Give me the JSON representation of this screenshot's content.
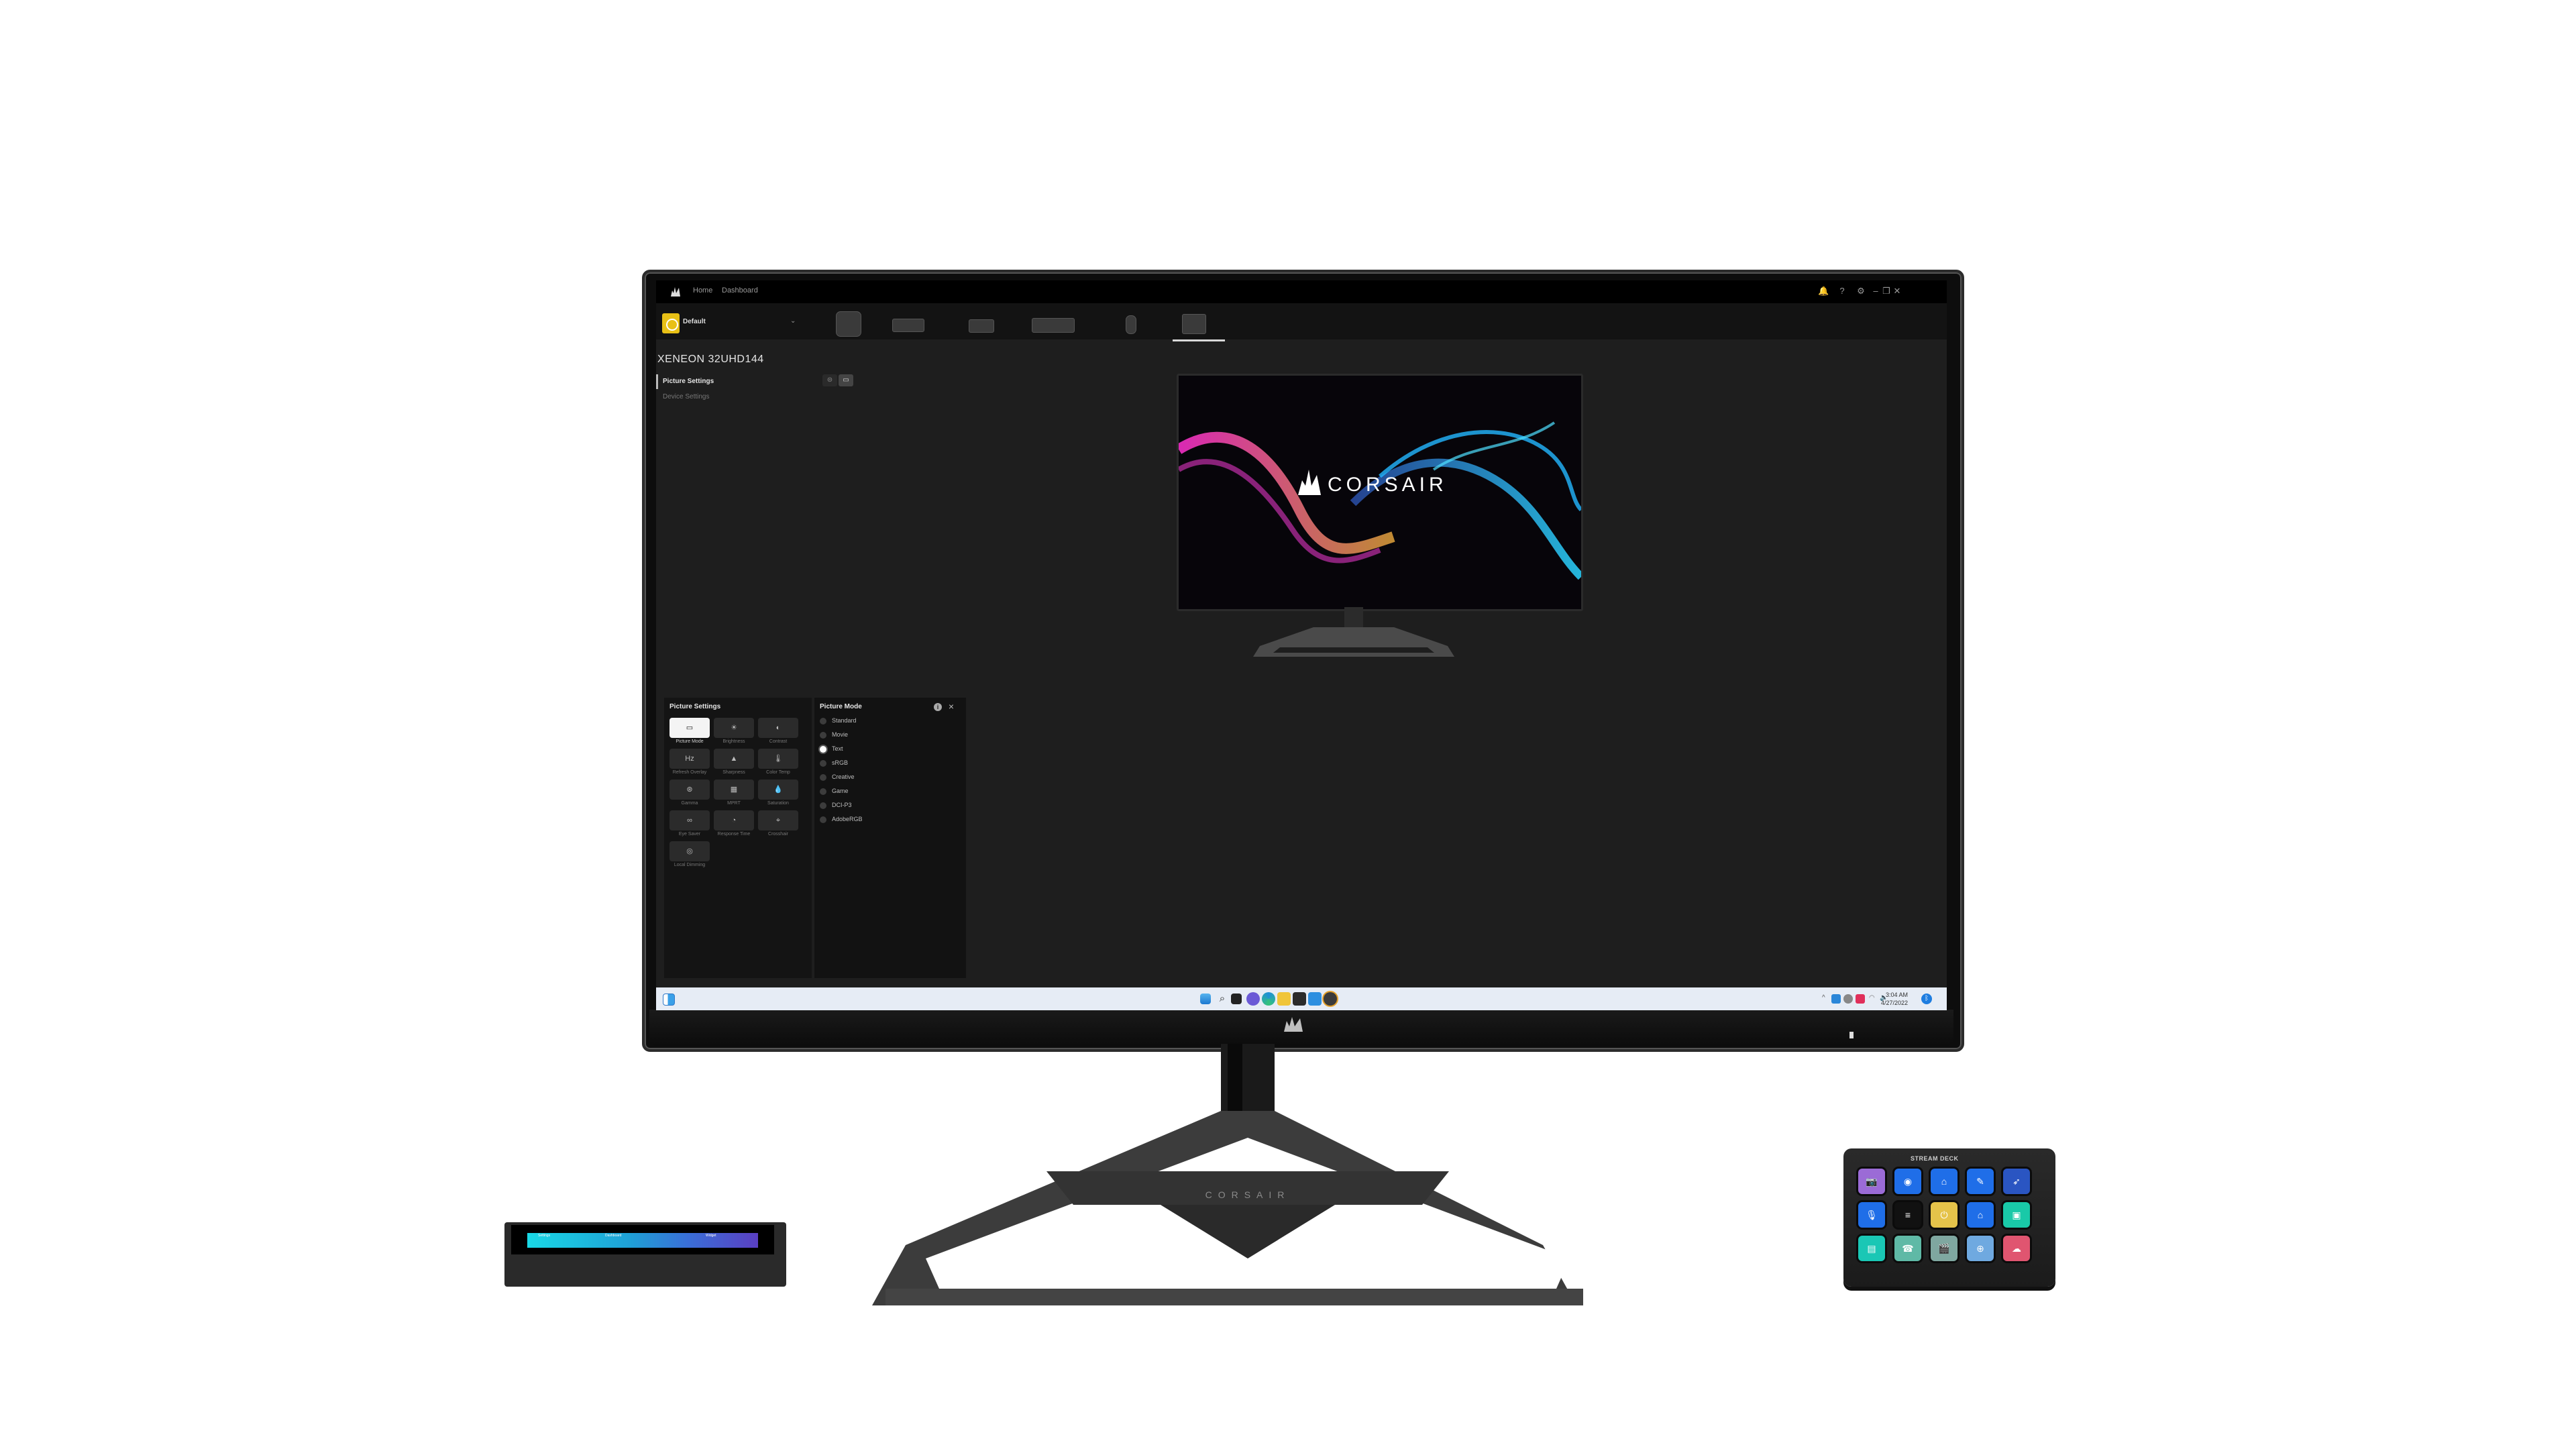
{
  "app": {
    "nav_links": [
      "Home",
      "Dashboard"
    ],
    "window_icons": [
      "bell-icon",
      "help-icon",
      "gear-icon",
      "minimize-icon",
      "restore-icon",
      "close-icon"
    ],
    "profile": {
      "name": "Default",
      "color": "#e8c016"
    },
    "devices": [
      "cooler",
      "memory",
      "mousepad",
      "keyboard",
      "mouse",
      "monitor"
    ],
    "active_device_index": 5,
    "device_title": "XENEON 32UHD144",
    "nav": [
      {
        "label": "Picture Settings",
        "active": true
      },
      {
        "label": "Device Settings",
        "active": false
      }
    ],
    "preview_brand": "CORSAIR",
    "picture_settings": {
      "title": "Picture Settings",
      "tiles": [
        {
          "label": "Picture Mode",
          "icon": "▭",
          "selected": true
        },
        {
          "label": "Brightness",
          "icon": "☀"
        },
        {
          "label": "Contrast",
          "icon": "◐"
        },
        {
          "label": "Refresh Overlay",
          "icon": "Hz"
        },
        {
          "label": "Sharpness",
          "icon": "▲"
        },
        {
          "label": "Color Temp",
          "icon": "🌡"
        },
        {
          "label": "Gamma",
          "icon": "⊛"
        },
        {
          "label": "MPRT",
          "icon": "▦"
        },
        {
          "label": "Saturation",
          "icon": "💧"
        },
        {
          "label": "Eye Saver",
          "icon": "∞"
        },
        {
          "label": "Response Time",
          "icon": "◔"
        },
        {
          "label": "Crosshair",
          "icon": "⌖"
        },
        {
          "label": "Local Dimming",
          "icon": "◎"
        }
      ]
    },
    "picture_mode": {
      "title": "Picture Mode",
      "options": [
        "Standard",
        "Movie",
        "Text",
        "sRGB",
        "Creative",
        "Game",
        "DCI-P3",
        "AdobeRGB"
      ],
      "selected": "Text"
    },
    "taskbar": {
      "apps": [
        "start",
        "search",
        "task-view",
        "teams-chat",
        "edge",
        "file-explorer",
        "store",
        "mail",
        "icue"
      ],
      "time": "3:04 AM",
      "date": "4/27/2022"
    }
  },
  "hardware": {
    "monitor_brand": "CORSAIR",
    "stand_brand": "CORSAIR",
    "stream_deck_label": "STREAM DECK",
    "edge_screen_items": [
      "Settings",
      "Dashboard",
      "Widget"
    ],
    "stream_deck_keys": [
      {
        "color": "#9b6bd6",
        "icon": "📷"
      },
      {
        "color": "#1f6ee8",
        "icon": "◉"
      },
      {
        "color": "#1f6ee8",
        "icon": "⌂"
      },
      {
        "color": "#1f6ee8",
        "icon": "✎"
      },
      {
        "color": "#2a55c2",
        "icon": "➶"
      },
      {
        "color": "#1f6ee8",
        "icon": "🎙"
      },
      {
        "color": "#111111",
        "icon": "≡"
      },
      {
        "color": "#e5c34a",
        "icon": "⏻"
      },
      {
        "color": "#1f6ee8",
        "icon": "⌂"
      },
      {
        "color": "#19c9a8",
        "icon": "▣"
      },
      {
        "color": "#1ac7b5",
        "icon": "▤"
      },
      {
        "color": "#5fb9a6",
        "icon": "☎"
      },
      {
        "color": "#7fa7a0",
        "icon": "🎬"
      },
      {
        "color": "#6fa9e0",
        "icon": "⊕"
      },
      {
        "color": "#e05570",
        "icon": "☁"
      }
    ]
  }
}
